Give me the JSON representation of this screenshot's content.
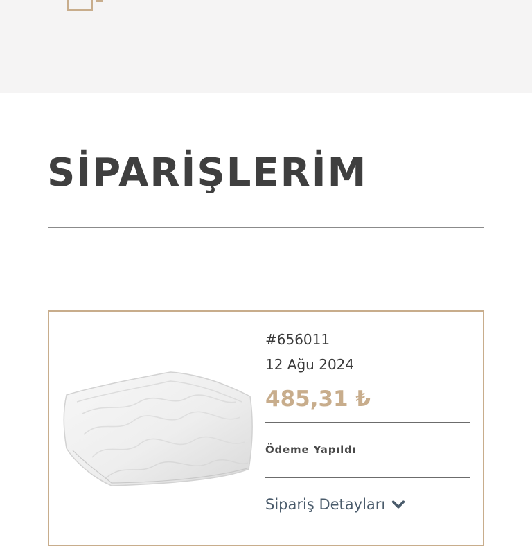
{
  "page": {
    "title": "SİPARİŞLERİM"
  },
  "order": {
    "number": "#656011",
    "date": "12 Ağu 2024",
    "total": "485,31 ₺",
    "payment_status": "Ödeme Yapıldı",
    "details_label": "Sipariş Detayları",
    "product_image": "pillow-image"
  },
  "icons": {
    "details_toggle": "chevron-down-icon"
  },
  "colors": {
    "accent": "#c8ad8c",
    "header_background": "#f5f4f4",
    "title_text": "#3f3f3f",
    "link_text": "#4a5b6b"
  }
}
